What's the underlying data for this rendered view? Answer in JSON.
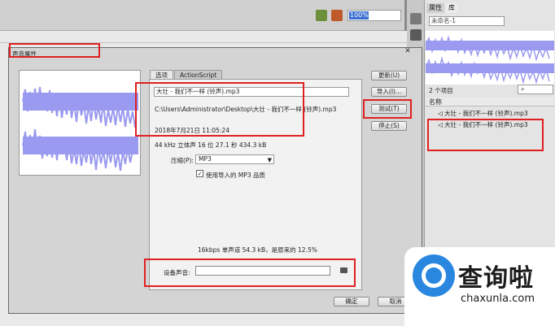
{
  "toolbar": {
    "zoom": "100%"
  },
  "library": {
    "tab_properties": "属性",
    "tab_library": "库",
    "document": "未命名-1",
    "count": "2 个项目",
    "column_name": "名称",
    "items": [
      "大壮 - 我们不一样 (铃声).mp3",
      "大壮 - 我们不一样 (铃声).mp3"
    ]
  },
  "dialog": {
    "title": "声音属性",
    "close": "✕",
    "tabs": [
      "选项",
      "ActionScript"
    ],
    "filename": "大壮 - 我们不一样 (铃声).mp3",
    "path": "C:\\Users\\Administrator\\Desktop\\大壮 - 我们不一样 (铃声).mp3",
    "date": "2018年7月21日  11:05:24",
    "info": "44 kHz 立体声 16 位 27.1 秒 434.3 kB",
    "compress_label": "压缩(P):",
    "compress_value": "MP3",
    "use_imported": "使用导入的 MP3 品质",
    "bitrate_info": "16kbps  单声道 54.3 kB，是原来的 12.5%",
    "device_sound_label": "设备声音:",
    "buttons": {
      "update": "更新(U)",
      "import": "导入(I)...",
      "test": "测试(T)",
      "stop": "停止(S)",
      "ok": "确定",
      "cancel": "取消"
    }
  },
  "watermark": {
    "brand": "查询啦",
    "url": "chaxunla.com"
  },
  "colors": {
    "wave": "#9a9af0",
    "highlight": "#e02020",
    "selection": "#3b6fd0"
  }
}
